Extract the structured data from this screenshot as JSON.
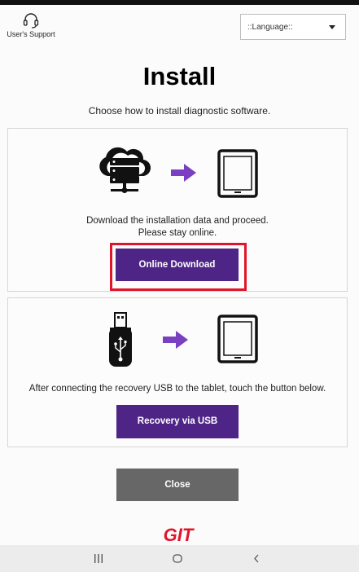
{
  "header": {
    "support_label": "User's Support",
    "language_value": "::Language::"
  },
  "page": {
    "title": "Install",
    "subtitle": "Choose how to install diagnostic software."
  },
  "online_card": {
    "line1": "Download the installation data and proceed.",
    "line2": "Please stay online.",
    "button_label": "Online Download"
  },
  "usb_card": {
    "text": "After connecting the recovery USB to the tablet, touch the button below.",
    "button_label": "Recovery via USB"
  },
  "footer": {
    "close_label": "Close",
    "logo_text": "GIT"
  },
  "colors": {
    "accent": "#4e2586",
    "arrow": "#7b3fc2",
    "highlight": "#e0142b",
    "logo": "#e0142b",
    "close": "#676767"
  },
  "icons": {
    "support": "headset-icon",
    "cloud_server": "cloud-server-icon",
    "arrow": "arrow-right-icon",
    "tablet": "tablet-icon",
    "usb": "usb-drive-icon",
    "nav_recents": "recents-icon",
    "nav_home": "home-icon",
    "nav_back": "back-icon"
  }
}
